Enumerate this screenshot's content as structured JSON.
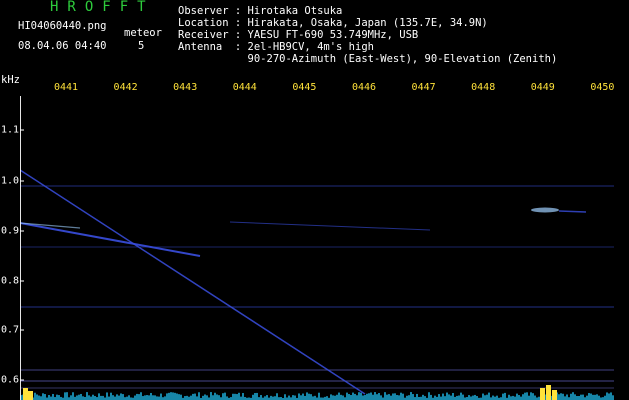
{
  "header": {
    "brand": "HROFFT",
    "filename": "HI04060440.png",
    "datetime": "08.04.06 04:40",
    "meteor_label": "meteor",
    "meteor_count": "5"
  },
  "station": [
    {
      "key": "Observer",
      "value": "Hirotaka Otsuka"
    },
    {
      "key": "Location",
      "value": "Hirakata, Osaka, Japan (135.7E, 34.9N)"
    },
    {
      "key": "Receiver",
      "value": "YAESU FT-690 53.749MHz, USB"
    },
    {
      "key": "Antenna",
      "value": "2el-HB9CV, 4m's high"
    },
    {
      "key": "",
      "value": "90-270-Azimuth (East-West), 90-Elevation (Zenith)"
    }
  ],
  "colors": {
    "brand": "#2ecc3c",
    "tick": "#ffe23a",
    "trace": "#3a4fe0",
    "trace_bright": "#9fd0ff",
    "noise": "#1fb3e0",
    "burst": "#ffe23a",
    "baseline": "#8080ff"
  },
  "spectrogram": {
    "y_unit": "kHz",
    "x_ticks": [
      "0441",
      "0442",
      "0443",
      "0444",
      "0445",
      "0446",
      "0447",
      "0448",
      "0449",
      "0450"
    ],
    "y_ticks": [
      "1.1",
      "1.0",
      "0.9",
      "0.8",
      "0.7",
      "0.6"
    ]
  }
}
